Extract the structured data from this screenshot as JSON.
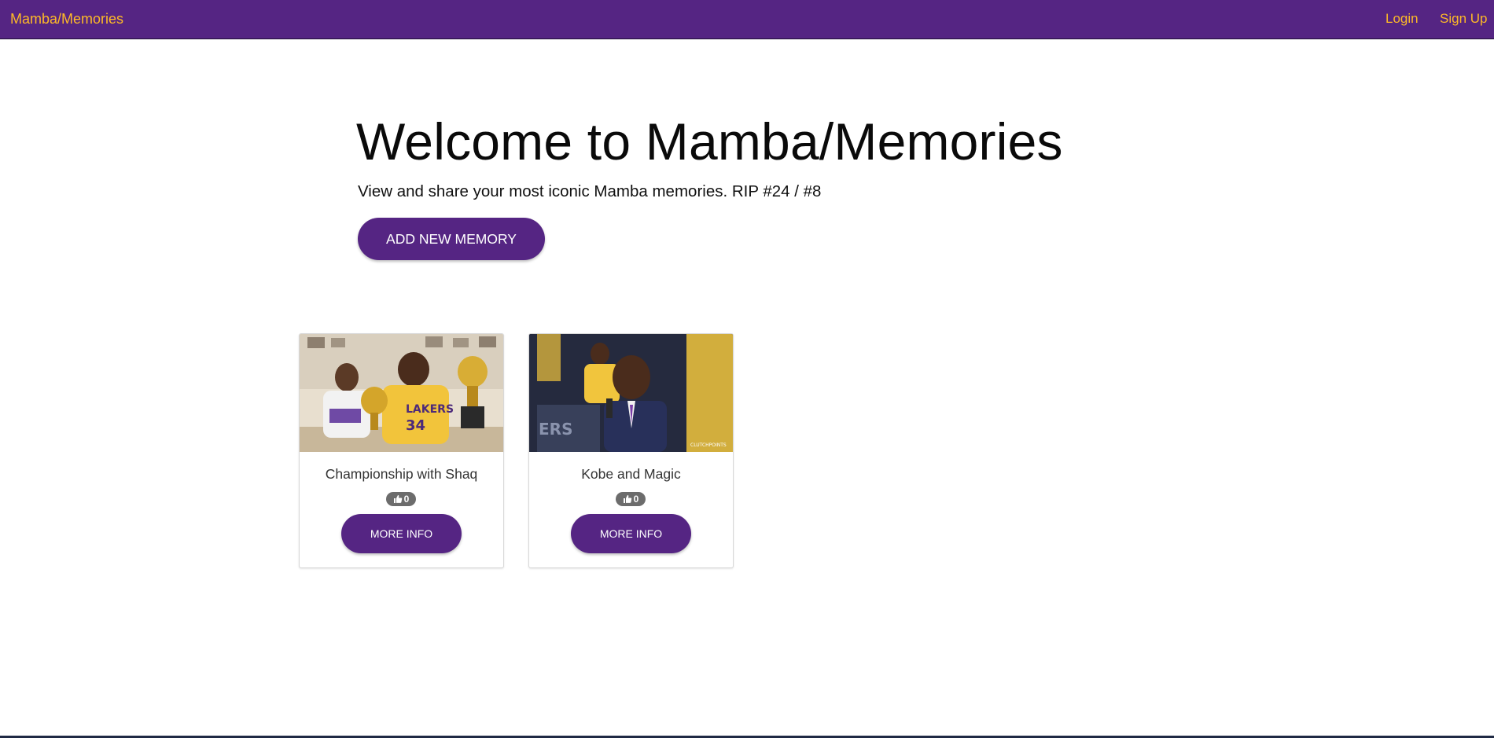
{
  "navbar": {
    "brand": "Mamba/Memories",
    "links": [
      {
        "label": "Login"
      },
      {
        "label": "Sign Up"
      }
    ],
    "colors": {
      "background": "#552583",
      "text": "#fdb927"
    }
  },
  "hero": {
    "title": "Welcome to Mamba/Memories",
    "subtitle": "View and share your most iconic Mamba memories. RIP #24 / #8",
    "add_button_label": "ADD NEW MEMORY"
  },
  "memories": [
    {
      "title": "Championship with Shaq",
      "likes": "0",
      "button_label": "MORE INFO",
      "image_icon": "photo-kobe-shaq-trophies"
    },
    {
      "title": "Kobe and Magic",
      "likes": "0",
      "button_label": "MORE INFO",
      "image_icon": "photo-kobe-magic"
    }
  ],
  "colors": {
    "primary": "#552583",
    "accent": "#fdb927",
    "badge": "#6c6c6c"
  }
}
